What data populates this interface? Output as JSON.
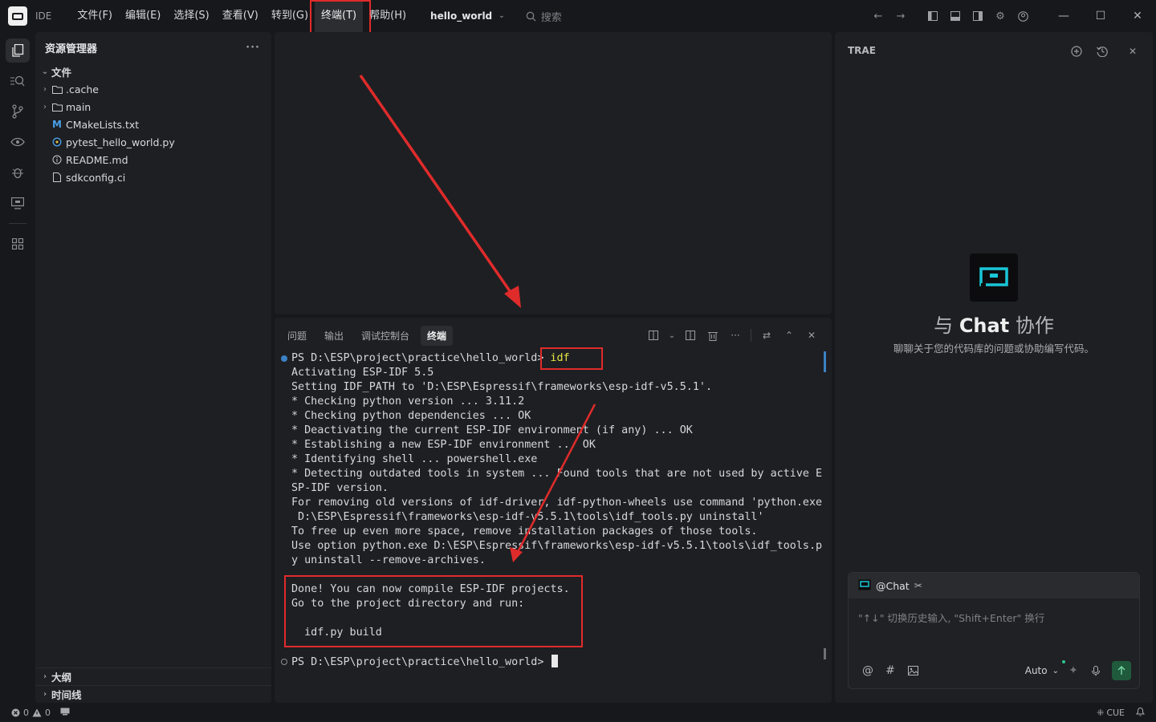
{
  "titlebar": {
    "ide_label": "IDE",
    "menus": [
      "文件(F)",
      "编辑(E)",
      "选择(S)",
      "查看(V)",
      "转到(G)",
      "终端(T)",
      "帮助(H)"
    ],
    "project": "hello_world",
    "search_placeholder": "搜索"
  },
  "sidebar": {
    "title": "资源管理器",
    "section": "文件",
    "items": [
      {
        "label": ".cache",
        "type": "folder"
      },
      {
        "label": "main",
        "type": "folder"
      },
      {
        "label": "CMakeLists.txt",
        "type": "cmake"
      },
      {
        "label": "pytest_hello_world.py",
        "type": "python"
      },
      {
        "label": "README.md",
        "type": "info"
      },
      {
        "label": "sdkconfig.ci",
        "type": "file"
      }
    ],
    "bottom_sections": [
      "大纲",
      "时间线"
    ]
  },
  "panel": {
    "tabs": [
      "问题",
      "输出",
      "调试控制台",
      "终端"
    ],
    "active_tab": "终端"
  },
  "terminal": {
    "prompt": "PS D:\\ESP\\project\\practice\\hello_world>",
    "command": "idf",
    "output": [
      "Activating ESP-IDF 5.5",
      "Setting IDF_PATH to 'D:\\ESP\\Espressif\\frameworks\\esp-idf-v5.5.1'.",
      "* Checking python version ... 3.11.2",
      "* Checking python dependencies ... OK",
      "* Deactivating the current ESP-IDF environment (if any) ... OK",
      "* Establishing a new ESP-IDF environment ... OK",
      "* Identifying shell ... powershell.exe",
      "* Detecting outdated tools in system ... Found tools that are not used by active E",
      "SP-IDF version.",
      "For removing old versions of idf-driver, idf-python-wheels use command 'python.exe",
      " D:\\ESP\\Espressif\\frameworks\\esp-idf-v5.5.1\\tools\\idf_tools.py uninstall'",
      "To free up even more space, remove installation packages of those tools.",
      "Use option python.exe D:\\ESP\\Espressif\\frameworks\\esp-idf-v5.5.1\\tools\\idf_tools.p",
      "y uninstall --remove-archives."
    ],
    "done": [
      "Done! You can now compile ESP-IDF projects.",
      "Go to the project directory and run:",
      "",
      "  idf.py build"
    ],
    "final_prompt": "PS D:\\ESP\\project\\practice\\hello_world>"
  },
  "ai": {
    "title": "TRAE",
    "heading_pre": "与",
    "heading_bold": "Chat",
    "heading_post": "协作",
    "subtitle": "聊聊关于您的代码库的问题或协助编写代码。",
    "chat_tag": "@Chat",
    "placeholder": "\"↑↓\" 切换历史输入, \"Shift+Enter\" 换行",
    "model": "Auto"
  },
  "status": {
    "errors": "0",
    "warnings": "0",
    "cue": "CUE"
  },
  "colors": {
    "highlight": "#e02b2b",
    "accent": "#3b82c4",
    "command": "#e5e545"
  }
}
